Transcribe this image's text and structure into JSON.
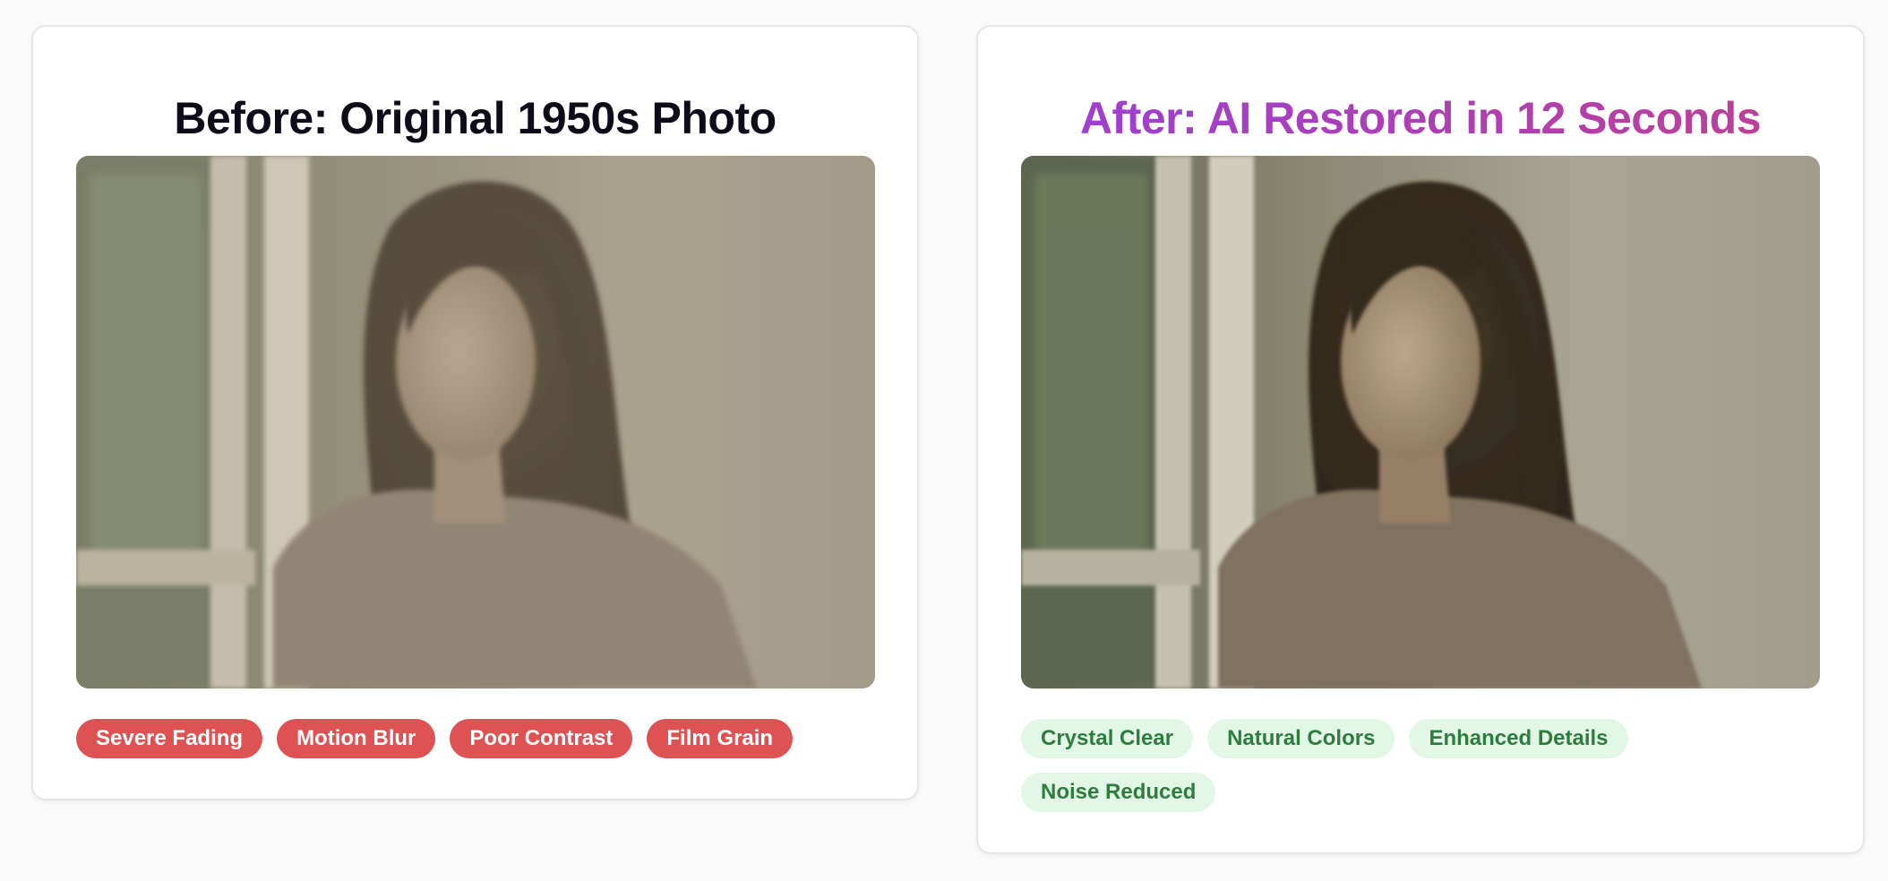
{
  "before_card": {
    "title": "Before: Original 1950s Photo",
    "image_label": "faded-portrait-photo",
    "tags": [
      "Severe Fading",
      "Motion Blur",
      "Poor Contrast",
      "Film Grain"
    ],
    "tag_color": "#df5253"
  },
  "after_card": {
    "title": "After: AI Restored in 12 Seconds",
    "image_label": "restored-portrait-photo",
    "title_gradient": [
      "#9b3fd8",
      "#c0408e"
    ],
    "tags": [
      "Crystal Clear",
      "Natural Colors",
      "Enhanced Details",
      "Noise Reduced"
    ],
    "tag_bg": "#e3f7e7",
    "tag_text_color": "#2e7d3e"
  }
}
